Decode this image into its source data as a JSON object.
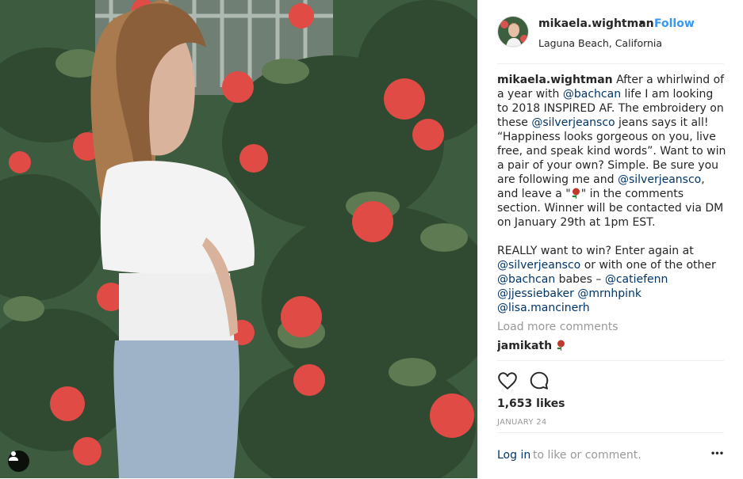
{
  "post": {
    "header": {
      "username": "mikaela.wightman",
      "separator": "•",
      "follow_label": "Follow",
      "location": "Laguna Beach, California"
    },
    "caption": {
      "username": "mikaela.wightman",
      "text_1": " After a whirlwind of a year with ",
      "mention_1": "@bachcan",
      "text_2": " life I am looking to 2018 INSPIRED AF. The embroidery on these ",
      "mention_2": "@silverjeansco",
      "text_3": " jeans says it all! “Happiness looks gorgeous on you, live free, and speak kind words”. Want to win a pair of your own? Simple. Be sure you are following me and ",
      "mention_3": "@silverjeansco",
      "text_4": ", and leave a \"",
      "text_5": "\" in the comments section. Winner will be contacted via DM on January 29th at 1pm EST.",
      "text_6": "REALLY want to win? Enter again at ",
      "mention_4": "@silverjeansco",
      "text_7": " or with one of the other ",
      "mention_5": "@bachcan",
      "text_8": " babes – ",
      "mention_6": "@catiefenn",
      "mention_7": "@jjessiebaker",
      "mention_8": "@mrnhpink",
      "mention_9": "@lisa.mancinerh"
    },
    "load_more_label": "Load more comments",
    "comments": [
      {
        "username": "jamikath"
      }
    ],
    "likes": "1,653 likes",
    "date": "JANUARY 24",
    "login": {
      "link": "Log in",
      "text": "to like or comment."
    },
    "more_options": "•••",
    "colors": {
      "link_blue": "#3897f0",
      "mention_navy": "#003569",
      "muted_gray": "#999999",
      "text_dark": "#262626",
      "divider": "#efefef"
    },
    "icons": {
      "like": "heart-outline-icon",
      "comment": "speech-bubble-icon",
      "user_tag": "user-silhouette-icon",
      "rose": "rose-emoji-icon"
    }
  }
}
